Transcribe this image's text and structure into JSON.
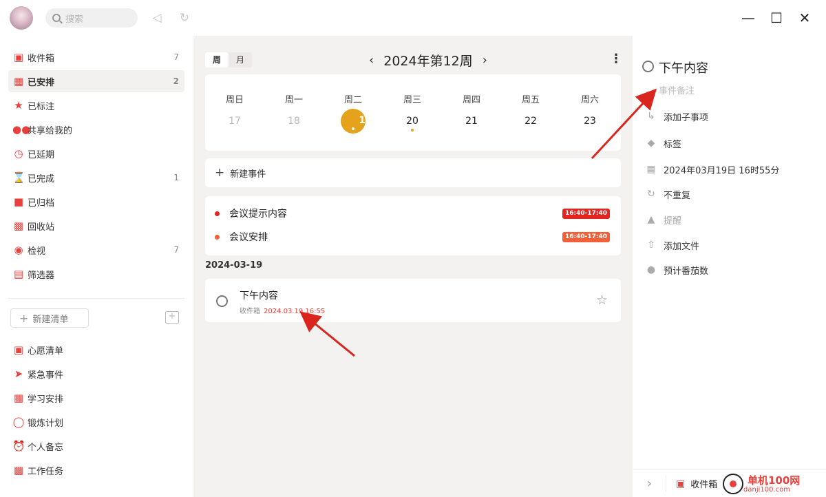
{
  "topbar": {
    "search_placeholder": "搜索",
    "controls": [
      "minimize-icon",
      "maximize-icon",
      "close-icon"
    ]
  },
  "sidebar": {
    "items": [
      {
        "label": "收件箱",
        "icon": "inbox-icon",
        "count": "7"
      },
      {
        "label": "已安排",
        "icon": "calendar-icon",
        "count": "2",
        "active": true
      },
      {
        "label": "已标注",
        "icon": "star-icon",
        "count": ""
      },
      {
        "label": "共享给我的",
        "icon": "users-icon",
        "count": ""
      },
      {
        "label": "已延期",
        "icon": "clock-icon",
        "count": ""
      },
      {
        "label": "已完成",
        "icon": "hourglass-icon",
        "count": "1"
      },
      {
        "label": "已归档",
        "icon": "box-icon",
        "count": ""
      },
      {
        "label": "回收站",
        "icon": "trash-icon",
        "count": ""
      },
      {
        "label": "检视",
        "icon": "binoculars-icon",
        "count": "7"
      },
      {
        "label": "筛选器",
        "icon": "filter-icon",
        "count": ""
      }
    ],
    "new_list_label": "新建清单",
    "lists": [
      {
        "label": "心愿清单",
        "icon": "gift-icon"
      },
      {
        "label": "紧急事件",
        "icon": "rocket-icon"
      },
      {
        "label": "学习安排",
        "icon": "book-icon"
      },
      {
        "label": "锻炼计划",
        "icon": "bike-icon"
      },
      {
        "label": "个人备忘",
        "icon": "alarm-icon"
      },
      {
        "label": "工作任务",
        "icon": "briefcase-icon"
      }
    ]
  },
  "center": {
    "view_tabs": [
      {
        "label": "周",
        "active": true
      },
      {
        "label": "月",
        "active": false
      }
    ],
    "week_title": "2024年第12周",
    "days": [
      {
        "name": "周日",
        "num": "17",
        "muted": true
      },
      {
        "name": "周一",
        "num": "18",
        "muted": true
      },
      {
        "name": "周二",
        "num": "19",
        "today": true
      },
      {
        "name": "周三",
        "num": "20",
        "dot": true
      },
      {
        "name": "周四",
        "num": "21"
      },
      {
        "name": "周五",
        "num": "22"
      },
      {
        "name": "周六",
        "num": "23"
      }
    ],
    "new_event_label": "新建事件",
    "events": [
      {
        "title": "会议提示内容",
        "time": "16:40-17:40",
        "color": "#e5231f"
      },
      {
        "title": "会议安排",
        "time": "16:40-17:40",
        "color": "#f2603a"
      }
    ],
    "date_heading": "2024-03-19",
    "task": {
      "title": "下午内容",
      "list": "收件箱",
      "due": "2024.03.19 16:55"
    }
  },
  "detail": {
    "title": "下午内容",
    "note_placeholder": "事件备注",
    "rows": [
      {
        "label": "添加子事项",
        "icon": "subtask-icon"
      },
      {
        "label": "标签",
        "icon": "tag-icon"
      },
      {
        "label": "2024年03月19日 16时55分",
        "icon": "calendar-icon"
      },
      {
        "label": "不重复",
        "icon": "repeat-icon"
      },
      {
        "label": "提醒",
        "icon": "bell-icon",
        "muted": true
      },
      {
        "label": "添加文件",
        "icon": "upload-icon"
      },
      {
        "label": "预计番茄数",
        "icon": "tomato-icon"
      }
    ],
    "bottom_list": "收件箱"
  },
  "watermark": {
    "title": "单机100网",
    "sub": "danji100.com"
  },
  "colors": {
    "accent": "#e8403c",
    "today": "#e5a21c",
    "panel_bg": "#f4f2f1"
  }
}
